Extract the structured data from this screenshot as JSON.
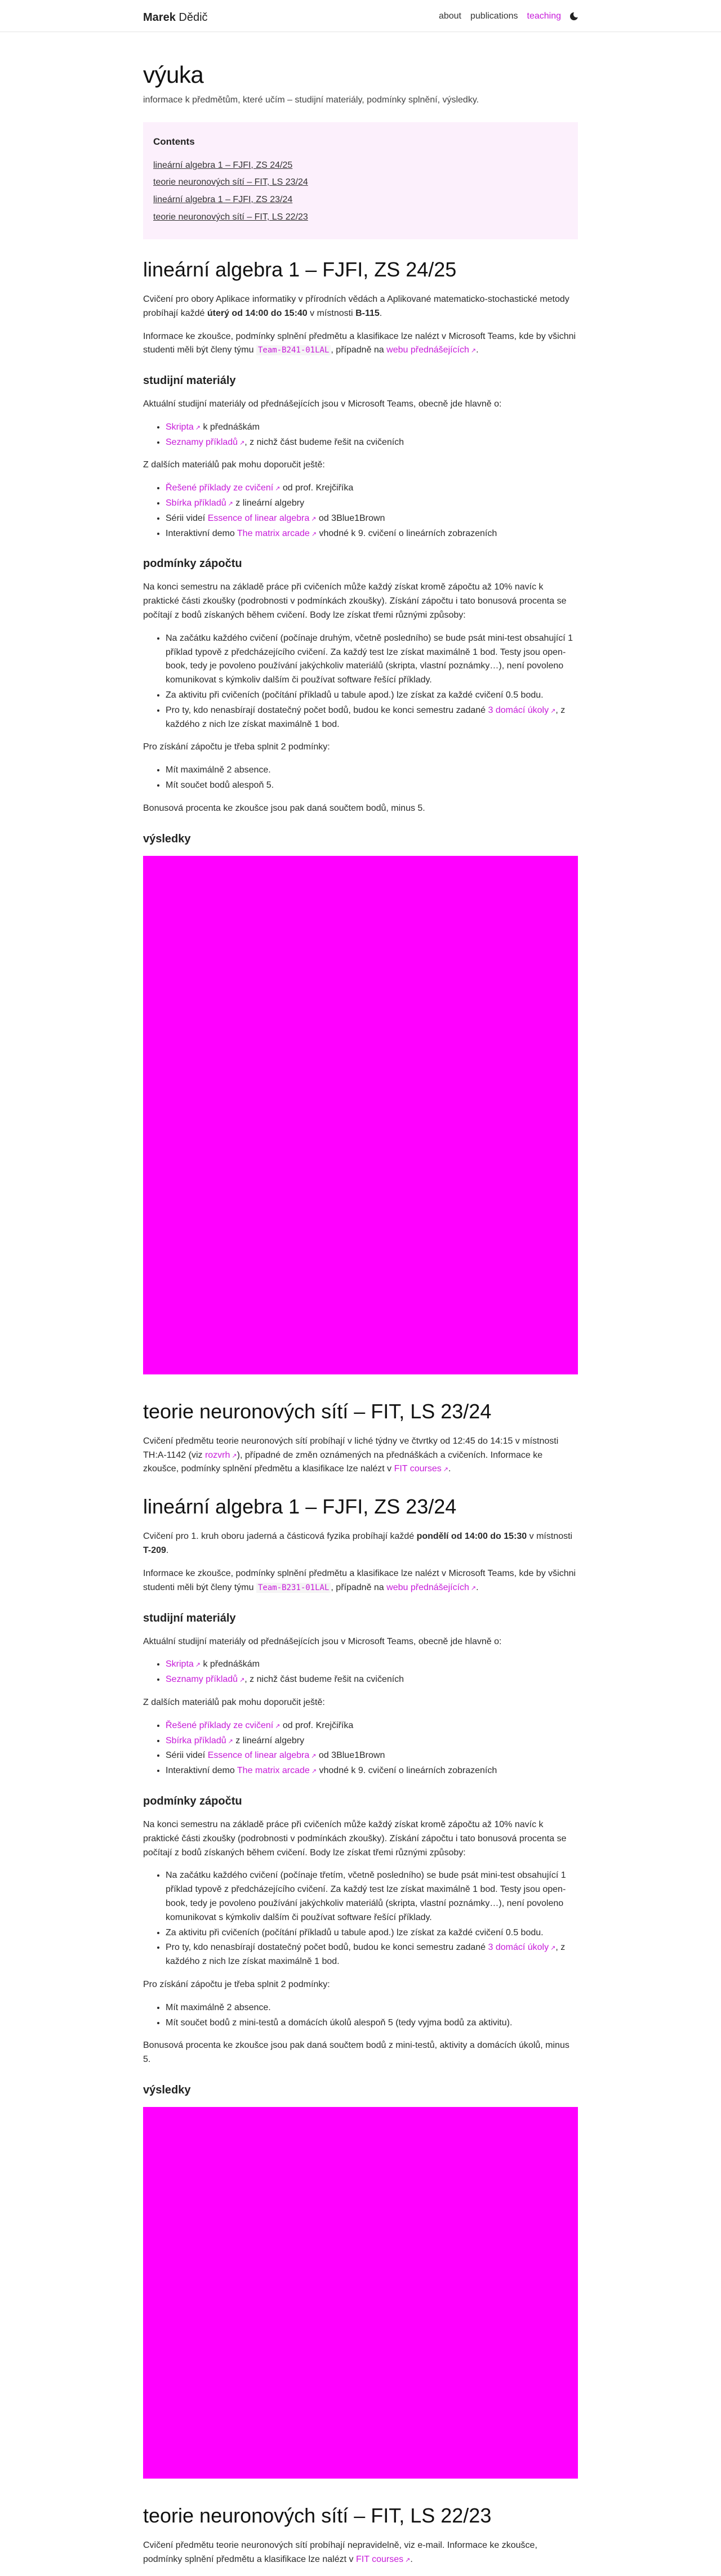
{
  "nav": {
    "brand_first": "Marek",
    "brand_last": "Dědič",
    "about": "about",
    "publications": "publications",
    "teaching": "teaching"
  },
  "page": {
    "title": "výuka",
    "description": "informace k předmětům, které učím – studijní materiály, podmínky splnění, výsledky."
  },
  "toc": {
    "heading": "Contents",
    "items": [
      "lineární algebra 1 – FJFI, ZS 24/25",
      "teorie neuronových sítí – FIT, LS 23/24",
      "lineární algebra 1 – FJFI, ZS 23/24",
      "teorie neuronových sítí – FIT, LS 22/23"
    ]
  },
  "s1": {
    "title": "lineární algebra 1 – FJFI, ZS 24/25",
    "intro_a": "Cvičení pro obory Aplikace informatiky v přírodních vědách a Aplikované matematicko-stochastické metody probíhají každé ",
    "intro_b": "úterý od 14:00 do 15:40",
    "intro_c": " v místnosti ",
    "intro_d": "B-115",
    "intro_e": ".",
    "teams_a": "Informace ke zkoušce, podmínky splnění předmětu a klasifikace lze nalézt v Microsoft Teams, kde by všichni studenti měli být členy týmu ",
    "teams_code": "Team-B241-01LAL",
    "teams_b": ", případně na ",
    "teams_link": "webu přednášejících",
    "teams_c": ".",
    "materials_h": "studijní materiály",
    "materials_p": "Aktuální studijní materiály od přednášejících jsou v Microsoft Teams, obecně jde hlavně o:",
    "m1_link": "Skripta",
    "m1_text": " k přednáškám",
    "m2_link": "Seznamy příkladů",
    "m2_text": ", z nichž část budeme řešit na cvičeních",
    "other_p": "Z dalších materiálů pak mohu doporučit ještě:",
    "o1_link": "Řešené příklady ze cvičení",
    "o1_text": " od prof. Krejčiříka",
    "o2_link": "Sbírka příkladů",
    "o2_text": " z lineární algebry",
    "o3_a": "Sérii videí ",
    "o3_link": "Essence of linear algebra",
    "o3_b": " od 3Blue1Brown",
    "o4_a": "Interaktivní demo ",
    "o4_link": "The matrix arcade",
    "o4_b": " vhodné k 9. cvičení o lineárních zobrazeních",
    "credit_h": "podmínky zápočtu",
    "credit_p": "Na konci semestru na základě práce při cvičeních může každý získat kromě zápočtu až 10% navíc k praktické části zkoušky (podrobnosti v podmínkách zkoušky). Získání zápočtu i tato bonusová procenta se počítají z bodů získaných během cvičení. Body lze získat třemi různými způsoby:",
    "c1": "Na začátku každého cvičení (počínaje druhým, včetně posledního) se bude psát mini-test obsahující 1 příklad typově z předcházejícího cvičení. Za každý test lze získat maximálně 1 bod. Testy jsou open-book, tedy je povoleno používání jakýchkoliv materiálů (skripta, vlastní poznámky…), není povoleno komunikovat s kýmkoliv dalším či používat software řešící příklady.",
    "c2": "Za aktivitu při cvičeních (počítání příkladů u tabule apod.) lze získat za každé cvičení 0.5 bodu.",
    "c3_a": "Pro ty, kdo nenasbírají dostatečný počet bodů, budou ke konci semestru zadané ",
    "c3_link": "3 domácí úkoly",
    "c3_b": ", z každého z nich lze získat maximálně 1 bod.",
    "req_p": "Pro získání zápočtu je třeba splnit 2 podmínky:",
    "r1": "Mít maximálně 2 absence.",
    "r2": "Mít součet bodů alespoň 5.",
    "bonus_p": "Bonusová procenta ke zkoušce jsou pak daná součtem bodů, minus 5.",
    "results_h": "výsledky"
  },
  "s2": {
    "title": "teorie neuronových sítí – FIT, LS 23/24",
    "p_a": "Cvičení předmětu teorie neuronových sítí probíhají v liché týdny ve čtvrtky od 12:45 do 14:15 v místnosti TH:A-1142 (viz ",
    "p_link1": "rozvrh",
    "p_b": "), případné de změn oznámených na přednáškách a cvičeních. Informace ke zkoušce, podmínky splnění předmětu a klasifikace lze nalézt v ",
    "p_link2": "FIT courses",
    "p_c": "."
  },
  "s3": {
    "title": "lineární algebra 1 – FJFI, ZS 23/24",
    "intro_a": "Cvičení pro 1. kruh oboru jaderná a částicová fyzika probíhají každé ",
    "intro_b": "pondělí od 14:00 do 15:30",
    "intro_c": " v místnosti ",
    "intro_d": "T-209",
    "intro_e": ".",
    "teams_a": "Informace ke zkoušce, podmínky splnění předmětu a klasifikace lze nalézt v Microsoft Teams, kde by všichni studenti měli být členy týmu ",
    "teams_code": "Team-B231-01LAL",
    "teams_b": ", případně na ",
    "teams_link": "webu přednášejících",
    "teams_c": ".",
    "materials_h": "studijní materiály",
    "materials_p": "Aktuální studijní materiály od přednášejících jsou v Microsoft Teams, obecně jde hlavně o:",
    "m1_link": "Skripta",
    "m1_text": " k přednáškám",
    "m2_link": "Seznamy příkladů",
    "m2_text": ", z nichž část budeme řešit na cvičeních",
    "other_p": "Z dalších materiálů pak mohu doporučit ještě:",
    "o1_link": "Řešené příklady ze cvičení",
    "o1_text": " od prof. Krejčiříka",
    "o2_link": "Sbírka příkladů",
    "o2_text": " z lineární algebry",
    "o3_a": "Sérii videí ",
    "o3_link": "Essence of linear algebra",
    "o3_b": " od 3Blue1Brown",
    "o4_a": "Interaktivní demo ",
    "o4_link": "The matrix arcade",
    "o4_b": " vhodné k 9. cvičení o lineárních zobrazeních",
    "credit_h": "podmínky zápočtu",
    "credit_p": "Na konci semestru na základě práce při cvičeních může každý získat kromě zápočtu až 10% navíc k praktické části zkoušky (podrobnosti v podmínkách zkoušky). Získání zápočtu i tato bonusová procenta se počítají z bodů získaných během cvičení. Body lze získat třemi různými způsoby:",
    "c1": "Na začátku každého cvičení (počínaje třetím, včetně posledního) se bude psát mini-test obsahující 1 příklad typově z předcházejícího cvičení. Za každý test lze získat maximálně 1 bod. Testy jsou open-book, tedy je povoleno používání jakýchkoliv materiálů (skripta, vlastní poznámky…), není povoleno komunikovat s kýmkoliv dalším či používat software řešící příklady.",
    "c2": "Za aktivitu při cvičeních (počítání příkladů u tabule apod.) lze získat za každé cvičení 0.5 bodu.",
    "c3_a": "Pro ty, kdo nenasbírají dostatečný počet bodů, budou ke konci semestru zadané ",
    "c3_link": "3 domácí úkoly",
    "c3_b": ", z každého z nich lze získat maximálně 1 bod.",
    "req_p": "Pro získání zápočtu je třeba splnit 2 podmínky:",
    "r1": "Mít maximálně 2 absence.",
    "r2": "Mít součet bodů z mini-testů a domácích úkolů alespoň 5 (tedy vyjma bodů za aktivitu).",
    "bonus_p": "Bonusová procenta ke zkoušce jsou pak daná součtem bodů z mini-testů, aktivity a domácích úkolů, minus 5.",
    "results_h": "výsledky"
  },
  "s4": {
    "title": "teorie neuronových sítí – FIT, LS 22/23",
    "p_a": "Cvičení předmětu teorie neuronových sítí probíhají nepravidelně, viz e-mail. Informace ke zkoušce, podmínky splnění předmětu a klasifikace lze nalézt v ",
    "p_link": "FIT courses",
    "p_b": "."
  },
  "colors": {
    "accent": "#c71bd9",
    "toc_bg": "#fcf0fc",
    "results_placeholder": "#ff00ff"
  },
  "icons": {
    "external_link": "↗",
    "theme_toggle": "moon"
  }
}
